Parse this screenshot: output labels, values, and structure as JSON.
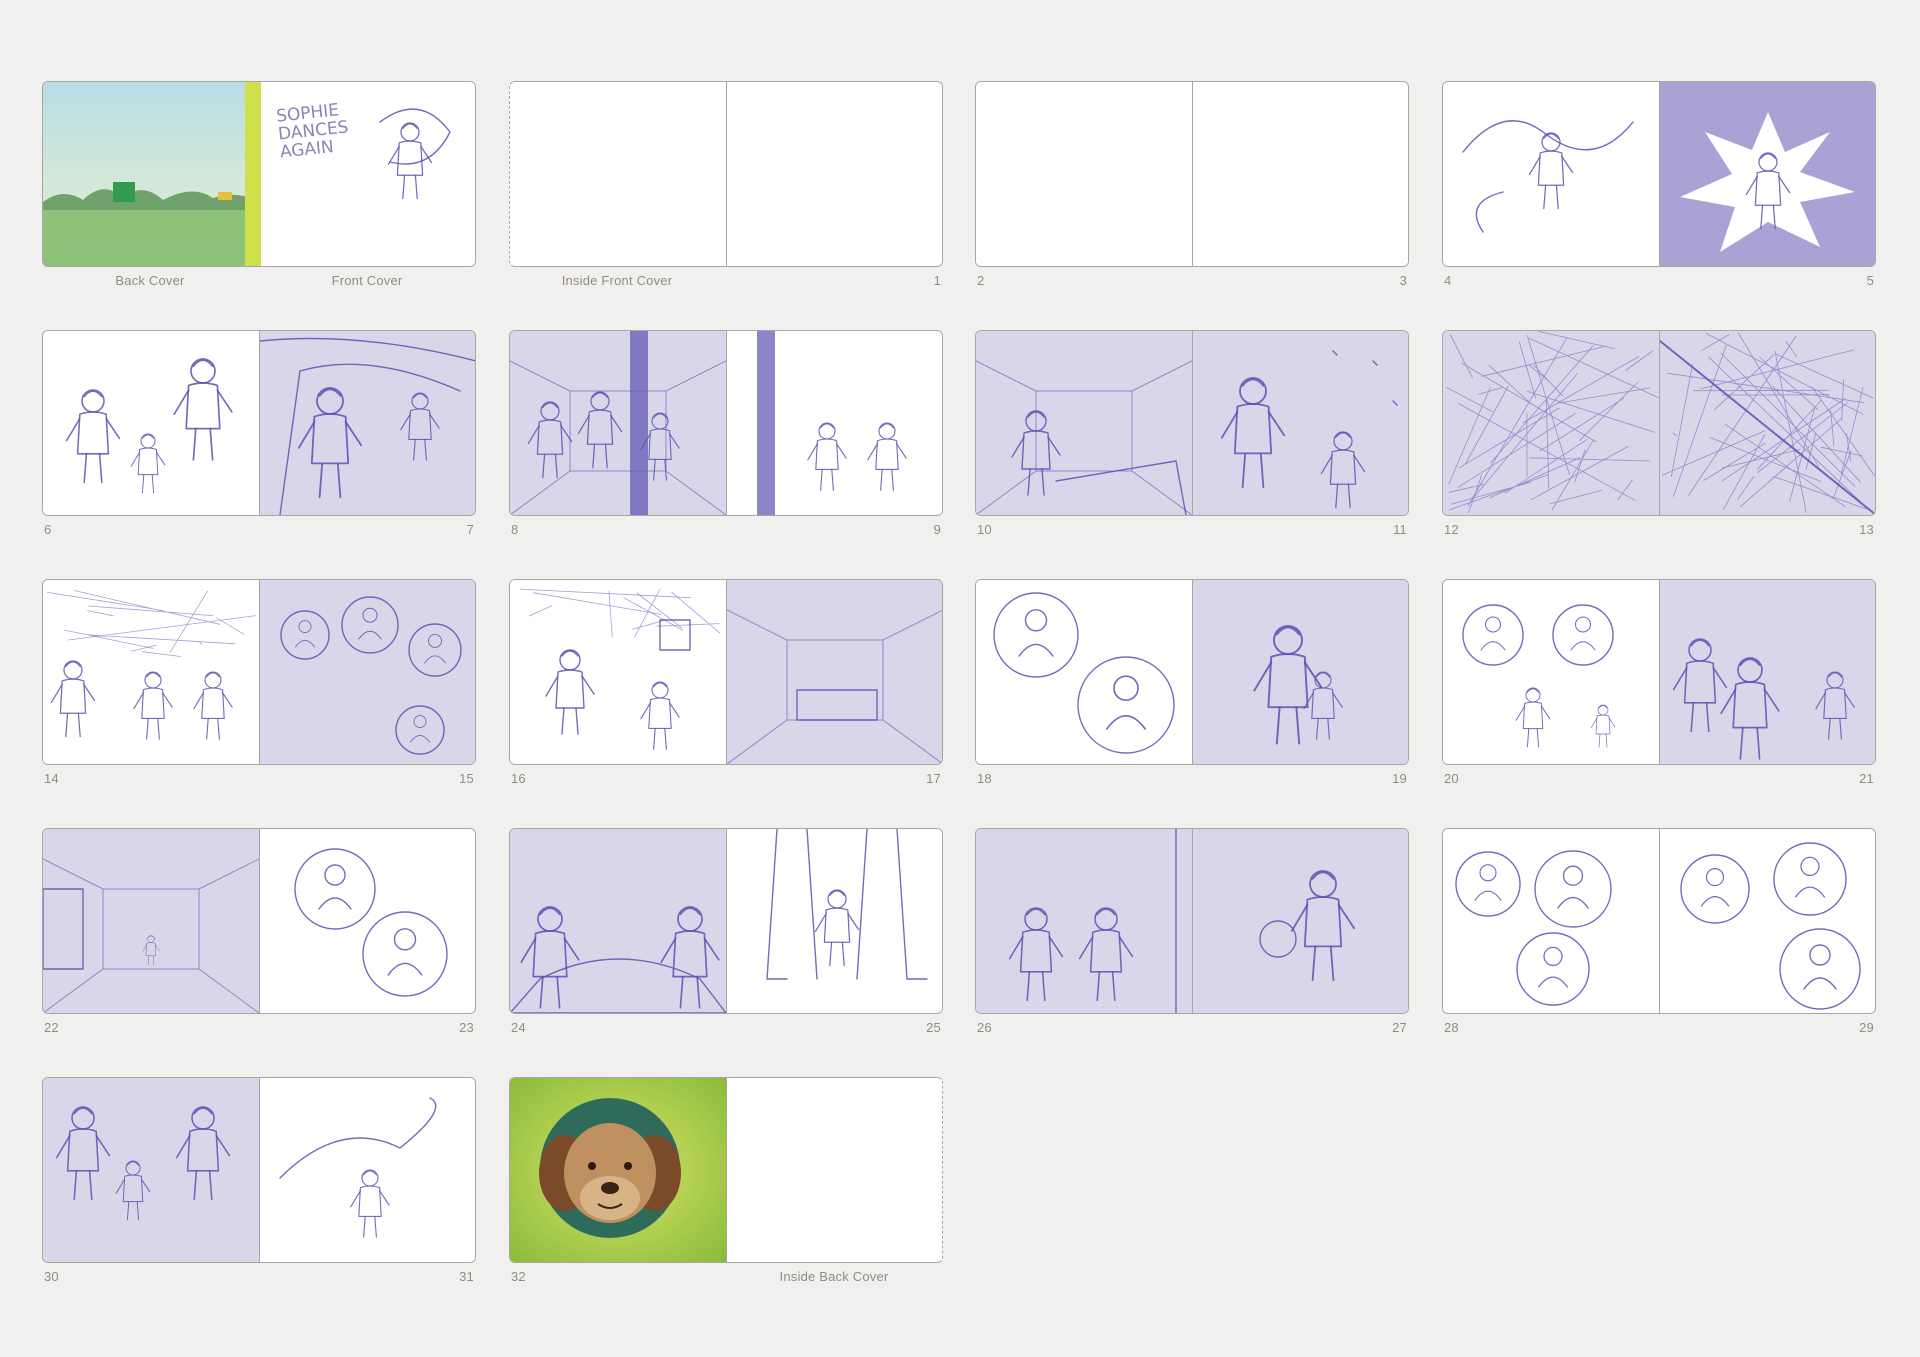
{
  "colors": {
    "background": "#f1f0ee",
    "page_white": "#ffffff",
    "page_lavender": "#d9d6ea",
    "page_lavender_strong": "#a9a2d4",
    "sketch_line": "#5b52b0",
    "spine_green": "#cfe04b",
    "caption": "#8f8c88"
  },
  "cover_art": {
    "title_lines": [
      "SOPHIE",
      "DANCES",
      "AGAIN"
    ]
  },
  "spreads": [
    {
      "left_label": "Back Cover",
      "right_label": "Front Cover",
      "left_bg": "cover-landscape",
      "right_bg": "white",
      "scene": "cover"
    },
    {
      "left_label": "Inside Front Cover",
      "right_label": "1",
      "left_bg": "white",
      "right_bg": "white",
      "scene": "blank"
    },
    {
      "left_label": "2",
      "right_label": "3",
      "left_bg": "white",
      "right_bg": "white",
      "scene": "blank"
    },
    {
      "left_label": "4",
      "right_label": "5",
      "left_bg": "white",
      "right_bg": "lavender-strong",
      "scene": "dance-burst"
    },
    {
      "left_label": "6",
      "right_label": "7",
      "left_bg": "white",
      "right_bg": "lavender",
      "scene": "family-car"
    },
    {
      "left_label": "8",
      "right_label": "9",
      "left_bg": "lavender",
      "right_bg": "white",
      "scene": "hospital-crowd"
    },
    {
      "left_label": "10",
      "right_label": "11",
      "left_bg": "lavender",
      "right_bg": "lavender",
      "scene": "hospital-bed"
    },
    {
      "left_label": "12",
      "right_label": "13",
      "left_bg": "lavender",
      "right_bg": "lavender",
      "scene": "chaos"
    },
    {
      "left_label": "14",
      "right_label": "15",
      "left_bg": "white",
      "right_bg": "lavender",
      "scene": "thought-bubbles"
    },
    {
      "left_label": "16",
      "right_label": "17",
      "left_bg": "white",
      "right_bg": "lavender",
      "scene": "corridor"
    },
    {
      "left_label": "18",
      "right_label": "19",
      "left_bg": "white",
      "right_bg": "lavender",
      "scene": "vignettes-hug"
    },
    {
      "left_label": "20",
      "right_label": "21",
      "left_bg": "white",
      "right_bg": "lavender",
      "scene": "vignettes-wave"
    },
    {
      "left_label": "22",
      "right_label": "23",
      "left_bg": "lavender",
      "right_bg": "white",
      "scene": "room-bubbles"
    },
    {
      "left_label": "24",
      "right_label": "25",
      "left_bg": "lavender",
      "right_bg": "white",
      "scene": "bed-legs"
    },
    {
      "left_label": "26",
      "right_label": "27",
      "left_bg": "lavender",
      "right_bg": "lavender",
      "scene": "teddy"
    },
    {
      "left_label": "28",
      "right_label": "29",
      "left_bg": "white",
      "right_bg": "white",
      "scene": "memories"
    },
    {
      "left_label": "30",
      "right_label": "31",
      "left_bg": "lavender",
      "right_bg": "white",
      "scene": "walk-dance"
    },
    {
      "left_label": "32",
      "right_label": "Inside Back Cover",
      "left_bg": "dog-portrait",
      "right_bg": "white",
      "scene": "dog"
    }
  ]
}
